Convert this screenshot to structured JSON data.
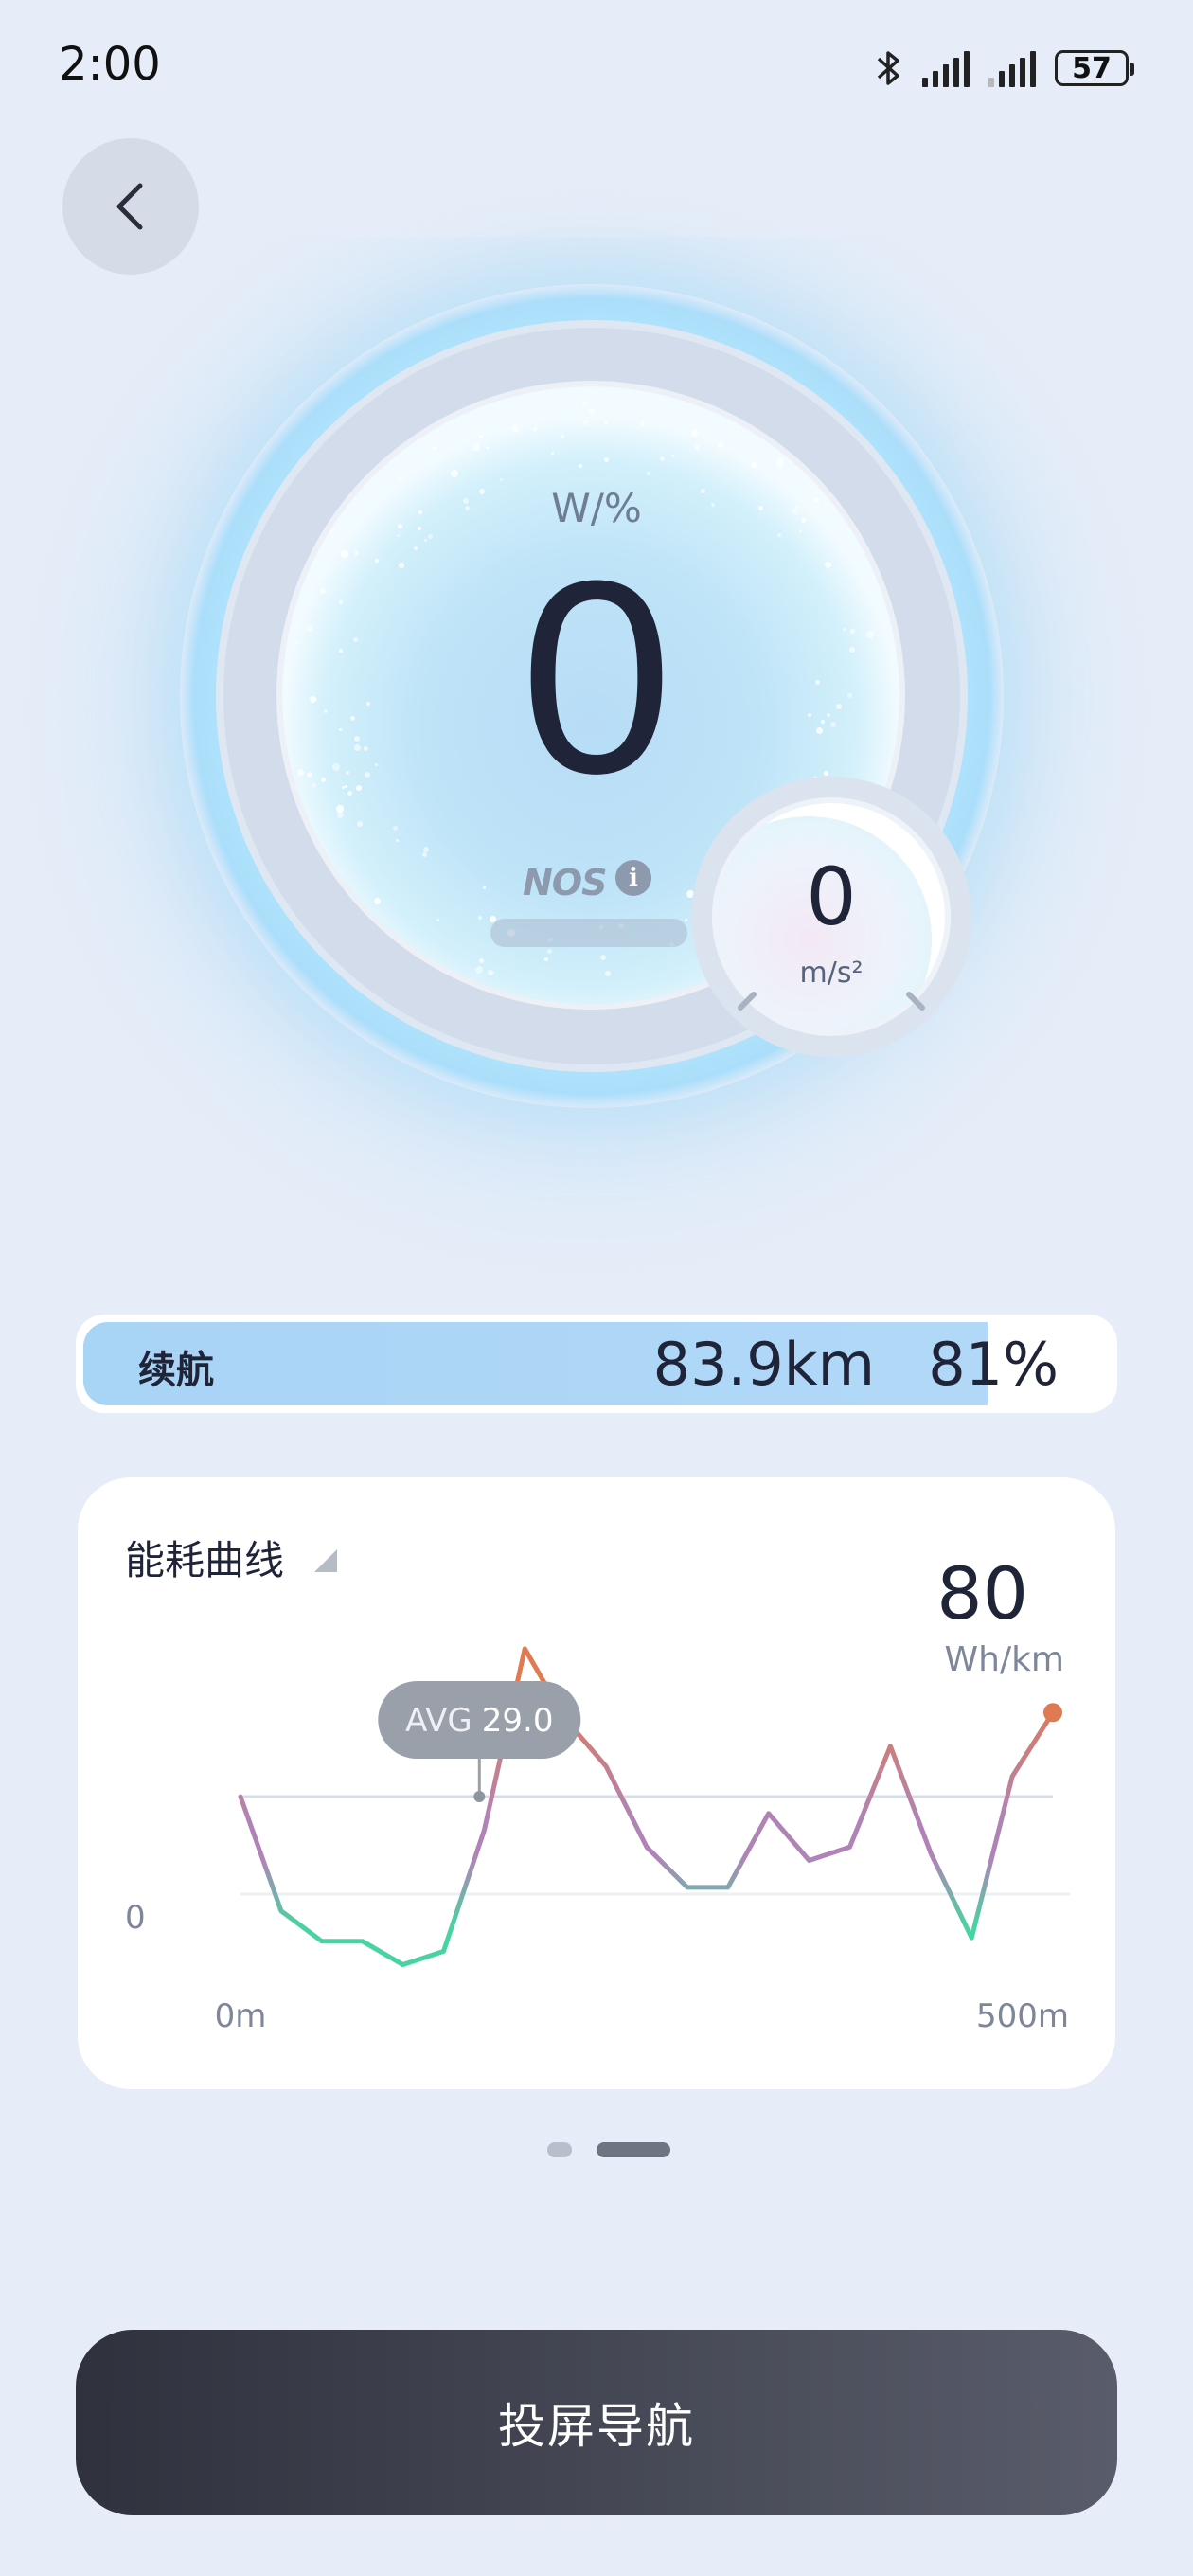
{
  "status_bar": {
    "time": "2:00",
    "battery": "57",
    "icons": [
      "bluetooth-icon",
      "signal-icon",
      "signal-icon"
    ]
  },
  "header": {
    "back_icon": "chevron-left-icon"
  },
  "gauge": {
    "unit": "W/%",
    "value": "0",
    "nos_label": "NOS",
    "info_icon": "info-icon",
    "accel_value": "0",
    "accel_unit": "m/s²"
  },
  "range": {
    "label": "续航",
    "distance": "83.9km",
    "percent": "81%",
    "fill_fraction": 0.81
  },
  "energy": {
    "title": "能耗曲线",
    "value": "80",
    "unit": "Wh/km",
    "colors": {
      "high": "#e07a52",
      "mid": "#b083b6",
      "low": "#49d3a2",
      "avg_line": "#d7dde6"
    }
  },
  "chart_data": {
    "type": "line",
    "x_start_label": "0m",
    "x_end_label": "500m",
    "y_zero_label": "0",
    "avg_label": "AVG",
    "avg_value": "29.0",
    "avg": 29.0,
    "x": [
      0,
      25,
      50,
      75,
      100,
      125,
      150,
      175,
      200,
      225,
      250,
      275,
      300,
      325,
      350,
      375,
      400,
      425,
      450,
      475,
      500
    ],
    "values": [
      29,
      -5,
      -14,
      -14,
      -21,
      -17,
      19,
      73,
      52,
      38,
      14,
      2,
      2,
      24,
      10,
      14,
      44,
      12,
      -13,
      35,
      54
    ]
  },
  "pager": {
    "count": 2,
    "active": 1
  },
  "actions": {
    "nav_button": "投屏导航"
  }
}
